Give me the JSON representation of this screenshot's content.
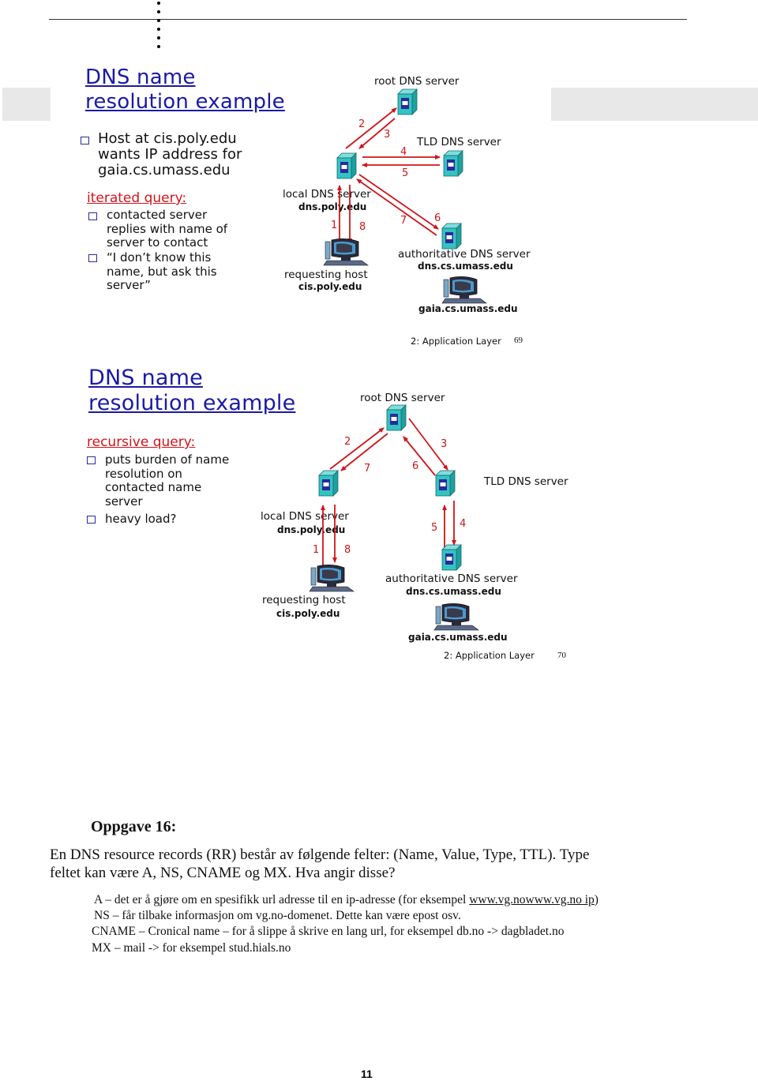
{
  "slide1": {
    "title_line1": "DNS name",
    "title_line2": "resolution example",
    "intro_bullet": [
      "Host at cis.poly.edu",
      "wants IP address for",
      "gaia.cs.umass.edu"
    ],
    "section": "iterated query:",
    "bullets": [
      [
        "contacted server",
        "replies with name of",
        "server to contact"
      ],
      [
        "“I don’t know this",
        "name, but ask this",
        "server”"
      ]
    ],
    "labels": {
      "root": "root DNS server",
      "tld": "TLD DNS server",
      "local": "local DNS server",
      "local_host": "dns.poly.edu",
      "requesting": "requesting host",
      "requesting_host": "cis.poly.edu",
      "authoritative": "authoritative DNS server",
      "authoritative_host": "dns.cs.umass.edu",
      "target_host": "gaia.cs.umass.edu"
    },
    "steps": [
      "1",
      "2",
      "3",
      "4",
      "5",
      "6",
      "7",
      "8"
    ],
    "footer": "2: Application Layer",
    "page": "69"
  },
  "slide2": {
    "title_line1": "DNS name",
    "title_line2": "resolution example",
    "section": "recursive query:",
    "bullets": [
      [
        "puts burden of name",
        "resolution on",
        "contacted name",
        "server"
      ],
      [
        "heavy load?"
      ]
    ],
    "labels": {
      "root": "root DNS server",
      "tld": "TLD DNS server",
      "local": "local DNS server",
      "local_host": "dns.poly.edu",
      "requesting": "requesting host",
      "requesting_host": "cis.poly.edu",
      "authoritative": "authoritative DNS server",
      "authoritative_host": "dns.cs.umass.edu",
      "target_host": "gaia.cs.umass.edu"
    },
    "steps": [
      "1",
      "2",
      "3",
      "4",
      "5",
      "6",
      "7",
      "8"
    ],
    "footer": "2: Application Layer",
    "page": "70"
  },
  "task": {
    "heading": "Oppgave 16:",
    "question_line1": "En DNS resource records (RR) består av følgende felter: (Name, Value, Type, TTL). Type",
    "question_line2": "feltet kan være A, NS, CNAME og MX. Hva angir disse?",
    "answers": {
      "a_prefix": "A – det er å gjøre om en spesifikk url adresse til en ip-adresse (for eksempel ",
      "a_link": "www.vg.nowww.vg.no ip",
      "a_suffix": ")",
      "ns": "NS – får tilbake informasjon om vg.no-domenet. Dette kan være epost osv.",
      "cname": "CNAME – Cronical name – for å slippe å skrive en lang url, for eksempel db.no -> dagbladet.no",
      "mx": "MX – mail -> for eksempel stud.hials.no"
    }
  },
  "page_number": "11",
  "colors": {
    "title_blue": "#1a1aa6",
    "accent_red": "#d0141a",
    "server_teal": "#33c3c3",
    "server_panel": "#2a2a9a",
    "band_grey": "#e8e8e8"
  }
}
